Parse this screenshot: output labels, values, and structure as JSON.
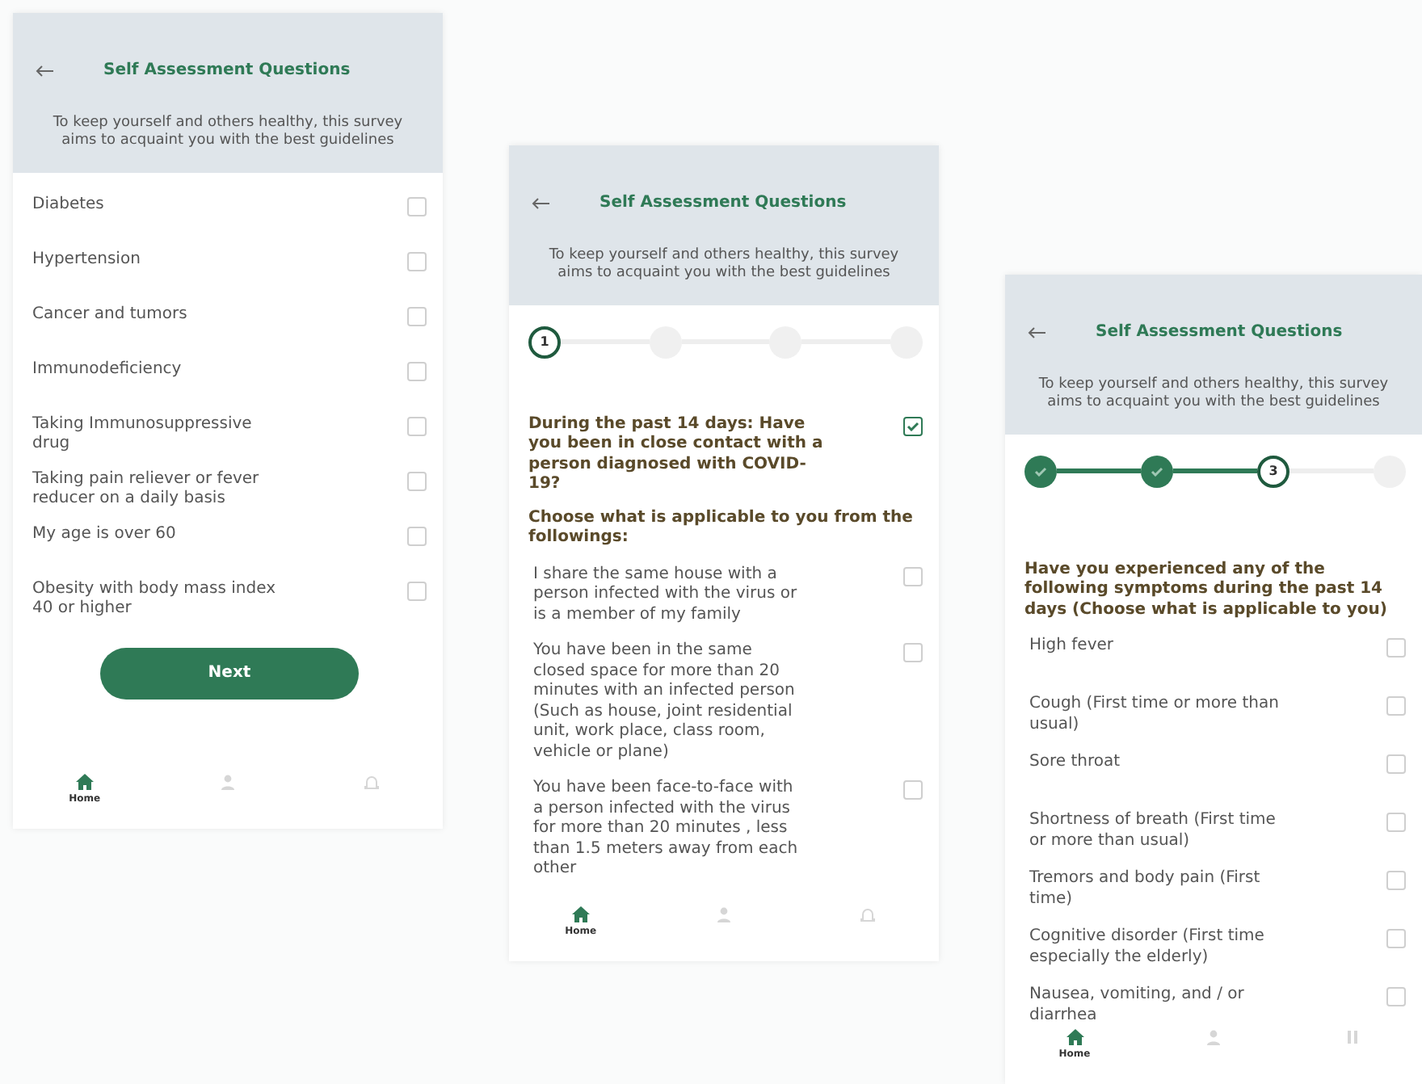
{
  "screens": [
    {
      "title": "Self Assessment Questions",
      "subtitle": "To keep yourself and others healthy, this survey aims to acquaint you with the best guidelines",
      "items": [
        {
          "label": "Diabetes",
          "checked": false
        },
        {
          "label": "Hypertension",
          "checked": false
        },
        {
          "label": "Cancer and tumors",
          "checked": false
        },
        {
          "label": "Immunodeficiency",
          "checked": false
        },
        {
          "label": "Taking Immunosuppressive drug",
          "checked": false
        },
        {
          "label": "Taking pain reliever or fever reducer on a daily basis",
          "checked": false
        },
        {
          "label": "My age is over 60",
          "checked": false
        },
        {
          "label": "Obesity with body mass index 40 or higher",
          "checked": false
        }
      ],
      "next_button": "Next",
      "nav": [
        {
          "kind": "home",
          "label": "Home",
          "selected": true
        },
        {
          "kind": "person",
          "selected": false
        },
        {
          "kind": "bell",
          "selected": false
        }
      ]
    },
    {
      "title": "Self Assessment Questions",
      "subtitle": "To keep yourself and others healthy, this survey aims to acquaint you with the best guidelines",
      "steps": [
        {
          "kind": "current",
          "label": "1"
        },
        {
          "kind": "pending"
        },
        {
          "kind": "pending"
        },
        {
          "kind": "pending"
        }
      ],
      "question": {
        "text": "During the past 14 days: Have you been in close contact with a person diagnosed with COVID-19?",
        "checked": true
      },
      "prompt": "Choose what is applicable to you from the followings:",
      "items": [
        {
          "label": "I share the same house with a person infected with the virus or is a member of my family",
          "checked": false
        },
        {
          "label": "You have been in the same closed space for more than 20 minutes with an infected person (Such as house, joint residential unit, work place, class room, vehicle or plane)",
          "checked": false
        },
        {
          "label": "You have been face-to-face with a person infected with the virus for more than 20 minutes , less than 1.5 meters away from each other",
          "checked": false
        }
      ],
      "nav": [
        {
          "kind": "home",
          "label": "Home",
          "selected": true
        },
        {
          "kind": "person",
          "selected": false
        },
        {
          "kind": "bell",
          "selected": false
        }
      ]
    },
    {
      "title": "Self Assessment Questions",
      "subtitle": "To keep yourself and others healthy, this survey aims to acquaint you with the best guidelines",
      "steps": [
        {
          "kind": "done"
        },
        {
          "kind": "done"
        },
        {
          "kind": "current",
          "label": "3"
        },
        {
          "kind": "pending"
        }
      ],
      "prompt": "Have you experienced any of the following symptoms during the past 14 days (Choose what is applicable to you)",
      "items": [
        {
          "label": "High fever",
          "checked": false
        },
        {
          "label": "Cough (First time or more than usual)",
          "checked": false
        },
        {
          "label": "Sore throat",
          "checked": false
        },
        {
          "label": "Shortness of breath (First time or more than usual)",
          "checked": false
        },
        {
          "label": "Tremors and body pain (First time)",
          "checked": false
        },
        {
          "label": "Cognitive disorder (First time especially the elderly)",
          "checked": false
        },
        {
          "label": "Nausea, vomiting, and / or diarrhea",
          "checked": false
        }
      ],
      "nav": [
        {
          "kind": "home",
          "label": "Home",
          "selected": true
        },
        {
          "kind": "person",
          "selected": false
        },
        {
          "kind": "pause",
          "selected": false
        }
      ]
    }
  ]
}
